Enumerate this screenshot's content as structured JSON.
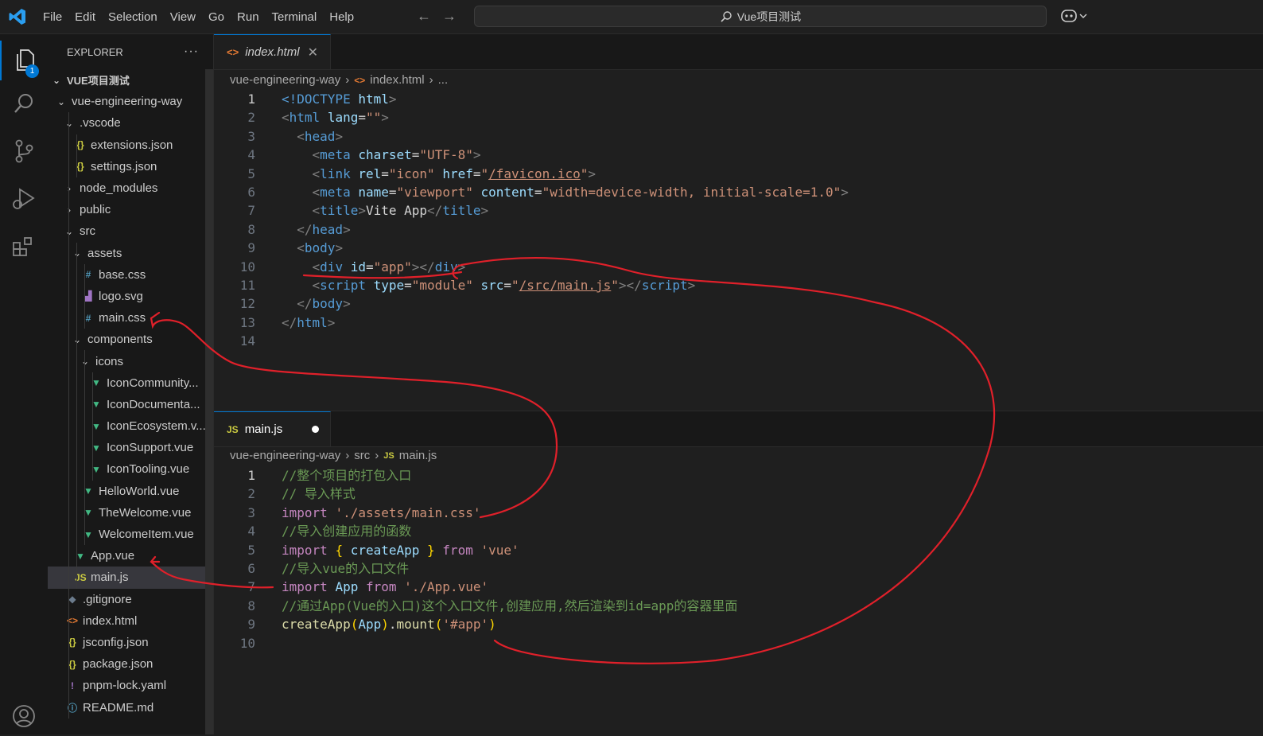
{
  "menu": {
    "items": [
      "File",
      "Edit",
      "Selection",
      "View",
      "Go",
      "Run",
      "Terminal",
      "Help"
    ]
  },
  "search": {
    "text": "Vue项目测试"
  },
  "activity": {
    "badge": "1",
    "icons": [
      "explorer-icon",
      "search-icon",
      "source-control-icon",
      "run-debug-icon",
      "extensions-icon",
      "account-icon"
    ]
  },
  "sidebar": {
    "title": "EXPLORER",
    "more": "···",
    "root": "VUE项目测试",
    "rows": [
      {
        "label": "vue-engineering-way",
        "type": "folder",
        "open": true,
        "depth": 1
      },
      {
        "label": ".vscode",
        "type": "folder",
        "open": true,
        "depth": 2
      },
      {
        "label": "extensions.json",
        "type": "json",
        "depth": 3
      },
      {
        "label": "settings.json",
        "type": "json",
        "depth": 3
      },
      {
        "label": "node_modules",
        "type": "folder",
        "open": false,
        "depth": 2
      },
      {
        "label": "public",
        "type": "folder",
        "open": false,
        "depth": 2
      },
      {
        "label": "src",
        "type": "folder",
        "open": true,
        "depth": 2
      },
      {
        "label": "assets",
        "type": "folder",
        "open": true,
        "depth": 3
      },
      {
        "label": "base.css",
        "type": "css",
        "depth": 4
      },
      {
        "label": "logo.svg",
        "type": "svg",
        "depth": 4
      },
      {
        "label": "main.css",
        "type": "css",
        "depth": 4
      },
      {
        "label": "components",
        "type": "folder",
        "open": true,
        "depth": 3
      },
      {
        "label": "icons",
        "type": "folder",
        "open": true,
        "depth": 4
      },
      {
        "label": "IconCommunity...",
        "type": "vue",
        "depth": 5
      },
      {
        "label": "IconDocumenta...",
        "type": "vue",
        "depth": 5
      },
      {
        "label": "IconEcosystem.v...",
        "type": "vue",
        "depth": 5
      },
      {
        "label": "IconSupport.vue",
        "type": "vue",
        "depth": 5
      },
      {
        "label": "IconTooling.vue",
        "type": "vue",
        "depth": 5
      },
      {
        "label": "HelloWorld.vue",
        "type": "vue",
        "depth": 4
      },
      {
        "label": "TheWelcome.vue",
        "type": "vue",
        "depth": 4
      },
      {
        "label": "WelcomeItem.vue",
        "type": "vue",
        "depth": 4
      },
      {
        "label": "App.vue",
        "type": "vue",
        "depth": 3
      },
      {
        "label": "main.js",
        "type": "js",
        "depth": 3,
        "selected": true
      },
      {
        "label": ".gitignore",
        "type": "git",
        "depth": 2
      },
      {
        "label": "index.html",
        "type": "html",
        "depth": 2
      },
      {
        "label": "jsconfig.json",
        "type": "json",
        "depth": 2
      },
      {
        "label": "package.json",
        "type": "json",
        "depth": 2
      },
      {
        "label": "pnpm-lock.yaml",
        "type": "yaml",
        "depth": 2
      },
      {
        "label": "README.md",
        "type": "info",
        "depth": 2
      }
    ]
  },
  "editor_top": {
    "tab": {
      "label": "index.html",
      "icon": "html-icon"
    },
    "breadcrumb": [
      "vue-engineering-way",
      "index.html",
      "..."
    ],
    "current_line": 1,
    "lines": [
      [
        {
          "t": "<!DOCTYPE ",
          "c": "tag"
        },
        {
          "t": "html",
          "c": "attr"
        },
        {
          "t": ">",
          "c": "pun"
        }
      ],
      [
        {
          "t": "<",
          "c": "pun"
        },
        {
          "t": "html ",
          "c": "tag"
        },
        {
          "t": "lang",
          "c": "attr"
        },
        {
          "t": "=",
          "c": "tx"
        },
        {
          "t": "\"\"",
          "c": "str"
        },
        {
          "t": ">",
          "c": "pun"
        }
      ],
      [
        {
          "t": "  <",
          "c": "pun"
        },
        {
          "t": "head",
          "c": "tag"
        },
        {
          "t": ">",
          "c": "pun"
        }
      ],
      [
        {
          "t": "    <",
          "c": "pun"
        },
        {
          "t": "meta ",
          "c": "tag"
        },
        {
          "t": "charset",
          "c": "attr"
        },
        {
          "t": "=",
          "c": "tx"
        },
        {
          "t": "\"UTF-8\"",
          "c": "str"
        },
        {
          "t": ">",
          "c": "pun"
        }
      ],
      [
        {
          "t": "    <",
          "c": "pun"
        },
        {
          "t": "link ",
          "c": "tag"
        },
        {
          "t": "rel",
          "c": "attr"
        },
        {
          "t": "=",
          "c": "tx"
        },
        {
          "t": "\"icon\" ",
          "c": "str"
        },
        {
          "t": "href",
          "c": "attr"
        },
        {
          "t": "=",
          "c": "tx"
        },
        {
          "t": "\"",
          "c": "str"
        },
        {
          "t": "/favicon.ico",
          "c": "str ul"
        },
        {
          "t": "\"",
          "c": "str"
        },
        {
          "t": ">",
          "c": "pun"
        }
      ],
      [
        {
          "t": "    <",
          "c": "pun"
        },
        {
          "t": "meta ",
          "c": "tag"
        },
        {
          "t": "name",
          "c": "attr"
        },
        {
          "t": "=",
          "c": "tx"
        },
        {
          "t": "\"viewport\" ",
          "c": "str"
        },
        {
          "t": "content",
          "c": "attr"
        },
        {
          "t": "=",
          "c": "tx"
        },
        {
          "t": "\"width=device-width, initial-scale=1.0\"",
          "c": "str"
        },
        {
          "t": ">",
          "c": "pun"
        }
      ],
      [
        {
          "t": "    <",
          "c": "pun"
        },
        {
          "t": "title",
          "c": "tag"
        },
        {
          "t": ">",
          "c": "pun"
        },
        {
          "t": "Vite App",
          "c": "tx"
        },
        {
          "t": "</",
          "c": "pun"
        },
        {
          "t": "title",
          "c": "tag"
        },
        {
          "t": ">",
          "c": "pun"
        }
      ],
      [
        {
          "t": "  </",
          "c": "pun"
        },
        {
          "t": "head",
          "c": "tag"
        },
        {
          "t": ">",
          "c": "pun"
        }
      ],
      [
        {
          "t": "  <",
          "c": "pun"
        },
        {
          "t": "body",
          "c": "tag"
        },
        {
          "t": ">",
          "c": "pun"
        }
      ],
      [
        {
          "t": "    <",
          "c": "pun"
        },
        {
          "t": "div ",
          "c": "tag"
        },
        {
          "t": "id",
          "c": "attr"
        },
        {
          "t": "=",
          "c": "tx"
        },
        {
          "t": "\"app\"",
          "c": "str"
        },
        {
          "t": "></",
          "c": "pun"
        },
        {
          "t": "div",
          "c": "tag"
        },
        {
          "t": ">",
          "c": "pun"
        }
      ],
      [
        {
          "t": "    <",
          "c": "pun"
        },
        {
          "t": "script ",
          "c": "tag"
        },
        {
          "t": "type",
          "c": "attr"
        },
        {
          "t": "=",
          "c": "tx"
        },
        {
          "t": "\"module\" ",
          "c": "str"
        },
        {
          "t": "src",
          "c": "attr"
        },
        {
          "t": "=",
          "c": "tx"
        },
        {
          "t": "\"",
          "c": "str"
        },
        {
          "t": "/src/main.js",
          "c": "str ul"
        },
        {
          "t": "\"",
          "c": "str"
        },
        {
          "t": "></",
          "c": "pun"
        },
        {
          "t": "script",
          "c": "tag"
        },
        {
          "t": ">",
          "c": "pun"
        }
      ],
      [
        {
          "t": "  </",
          "c": "pun"
        },
        {
          "t": "body",
          "c": "tag"
        },
        {
          "t": ">",
          "c": "pun"
        }
      ],
      [
        {
          "t": "</",
          "c": "pun"
        },
        {
          "t": "html",
          "c": "tag"
        },
        {
          "t": ">",
          "c": "pun"
        }
      ],
      []
    ]
  },
  "editor_bottom": {
    "tab": {
      "label": "main.js",
      "icon": "js-icon",
      "modified": true
    },
    "breadcrumb": [
      "vue-engineering-way",
      "src",
      "main.js"
    ],
    "current_line": 1,
    "lines": [
      [
        {
          "t": "//整个项目的打包入口",
          "c": "com"
        }
      ],
      [
        {
          "t": "// 导入样式",
          "c": "com"
        }
      ],
      [
        {
          "t": "import ",
          "c": "kw"
        },
        {
          "t": "'./assets/main.css'",
          "c": "str"
        }
      ],
      [
        {
          "t": "//导入创建应用的函数",
          "c": "com"
        }
      ],
      [
        {
          "t": "import ",
          "c": "kw"
        },
        {
          "t": "{ ",
          "c": "brk"
        },
        {
          "t": "createApp ",
          "c": "var"
        },
        {
          "t": "} ",
          "c": "brk"
        },
        {
          "t": "from ",
          "c": "kw"
        },
        {
          "t": "'vue'",
          "c": "str"
        }
      ],
      [
        {
          "t": "//导入vue的入口文件",
          "c": "com"
        }
      ],
      [
        {
          "t": "import ",
          "c": "kw"
        },
        {
          "t": "App ",
          "c": "var"
        },
        {
          "t": "from ",
          "c": "kw"
        },
        {
          "t": "'./App.vue'",
          "c": "str"
        }
      ],
      [
        {
          "t": "//通过App(Vue的入口)这个入口文件,创建应用,然后渲染到id=app的容器里面",
          "c": "com"
        }
      ],
      [
        {
          "t": "createApp",
          "c": "fn"
        },
        {
          "t": "(",
          "c": "brk"
        },
        {
          "t": "App",
          "c": "var"
        },
        {
          "t": ")",
          "c": "brk"
        },
        {
          "t": ".",
          "c": "tx"
        },
        {
          "t": "mount",
          "c": "fn"
        },
        {
          "t": "(",
          "c": "brk"
        },
        {
          "t": "'#app'",
          "c": "str"
        },
        {
          "t": ")",
          "c": "brk"
        }
      ],
      []
    ]
  },
  "colors": {
    "accent": "#0078d4",
    "annotation": "#e0202a",
    "vue": "#42b883",
    "json": "#cbcb41",
    "css": "#519aba",
    "html": "#e37933",
    "js": "#cbcb41"
  }
}
